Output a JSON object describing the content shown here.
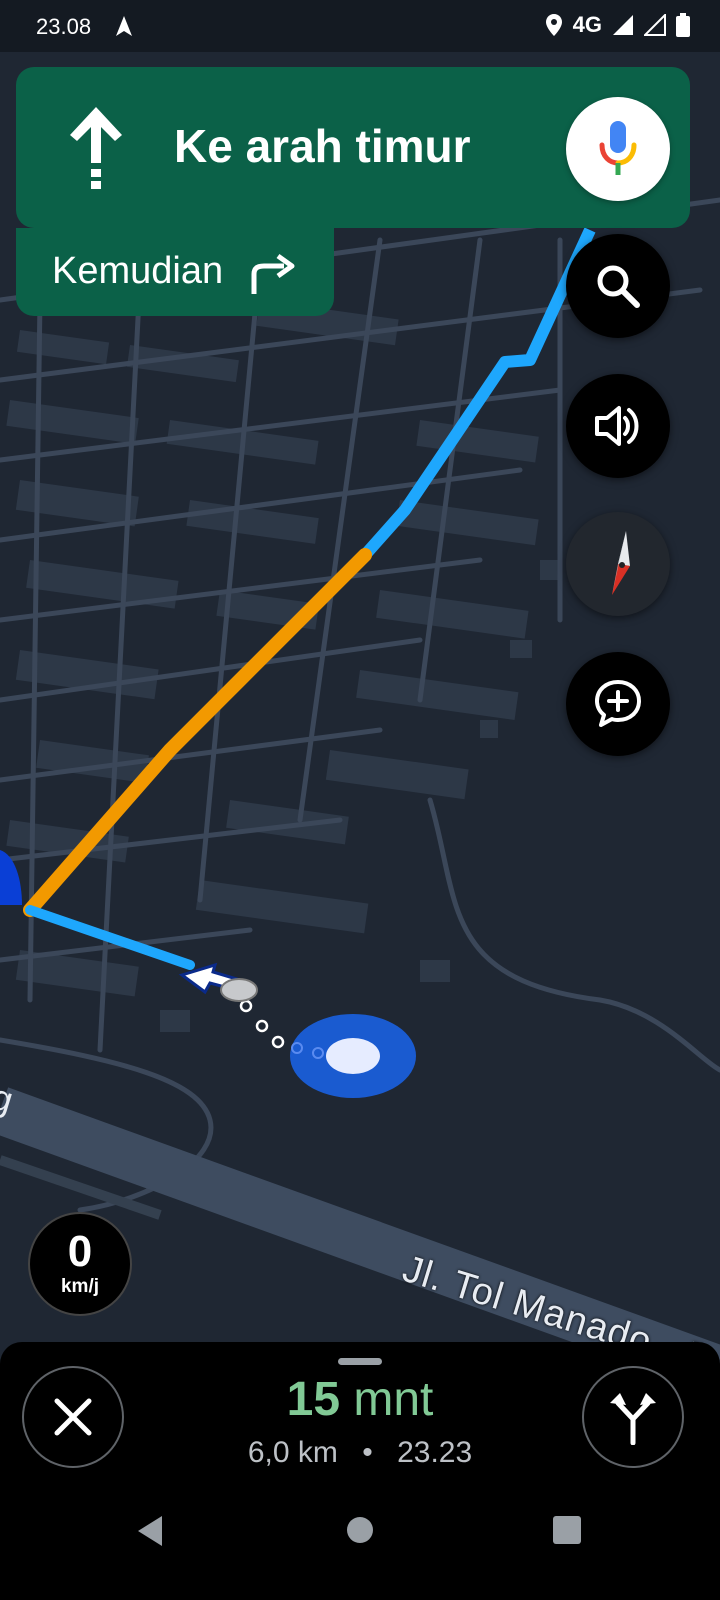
{
  "status_bar": {
    "time": "23.08",
    "network": "4G"
  },
  "navigation": {
    "instruction": "Ke arah timur",
    "then_label": "Kemudian",
    "icons": {
      "direction": "straight-arrow-icon",
      "then": "turn-right-icon",
      "voice": "microphone-icon"
    }
  },
  "map": {
    "road_label": "Jl. Tol Manado - B",
    "route_color": "#1ea7fd",
    "traffic_color": "#f29900",
    "buttons": [
      "search-icon",
      "volume-icon",
      "compass-icon",
      "add-report-icon"
    ]
  },
  "speed": {
    "value": "0",
    "unit": "km/j"
  },
  "trip": {
    "duration_value": "15",
    "duration_unit": "mnt",
    "distance": "6,0 km",
    "separator": "•",
    "arrival": "23.23"
  },
  "colors": {
    "banner": "#0b6148",
    "eta": "#81c995"
  }
}
